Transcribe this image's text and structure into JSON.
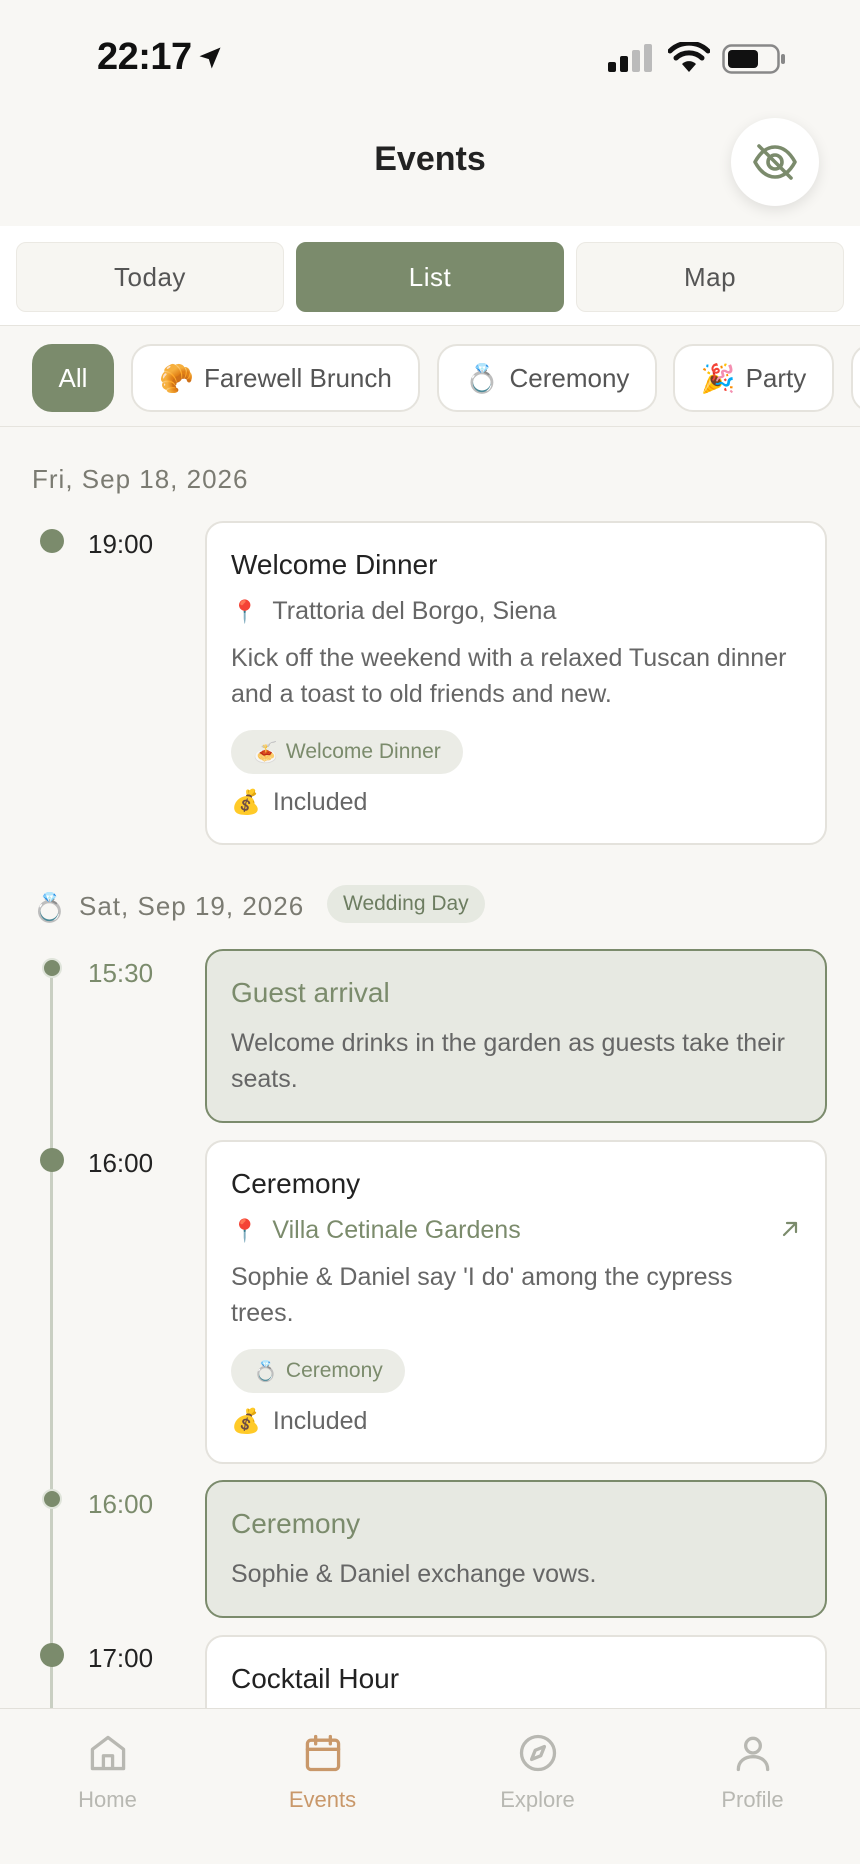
{
  "status": {
    "time": "22:17"
  },
  "header": {
    "title": "Events"
  },
  "segments": [
    {
      "label": "Today",
      "active": false
    },
    {
      "label": "List",
      "active": true
    },
    {
      "label": "Map",
      "active": false
    }
  ],
  "filters": [
    {
      "label": "All",
      "emoji": "",
      "active": true
    },
    {
      "label": "Farewell Brunch",
      "emoji": "🥐",
      "active": false
    },
    {
      "label": "Ceremony",
      "emoji": "💍",
      "active": false
    },
    {
      "label": "Party",
      "emoji": "🎉",
      "active": false
    }
  ],
  "days": [
    {
      "date": "Fri, Sep 18, 2026",
      "events": [
        {
          "time": "19:00",
          "title": "Welcome Dinner",
          "location": "Trattoria del Borgo, Siena",
          "description": "Kick off the weekend with a relaxed Tuscan dinner and a toast to old friends and new.",
          "tag": "Welcome Dinner",
          "tag_emoji": "🍝",
          "price": "Included",
          "price_emoji": "💰"
        }
      ]
    },
    {
      "date": "Sat, Sep 19, 2026",
      "date_emoji": "💍",
      "badge": "Wedding Day",
      "events": [
        {
          "time": "15:30",
          "title": "Guest arrival",
          "description": "Welcome drinks in the garden as guests take their seats."
        },
        {
          "time": "16:00",
          "title": "Ceremony",
          "location": "Villa Cetinale Gardens",
          "description": "Sophie & Daniel say 'I do' among the cypress trees.",
          "tag": "Ceremony",
          "tag_emoji": "💍",
          "price": "Included",
          "price_emoji": "💰"
        },
        {
          "time": "16:00",
          "title": "Ceremony",
          "description": "Sophie & Daniel exchange vows."
        },
        {
          "time": "17:00",
          "title": "Cocktail Hour"
        }
      ]
    }
  ],
  "pin_emoji": "📍",
  "tabs": [
    {
      "label": "Home",
      "icon": "home-icon",
      "active": false
    },
    {
      "label": "Events",
      "icon": "calendar-icon",
      "active": true
    },
    {
      "label": "Explore",
      "icon": "compass-icon",
      "active": false
    },
    {
      "label": "Profile",
      "icon": "person-icon",
      "active": false
    }
  ],
  "colors": {
    "accent": "#7b8b6c",
    "tab_active": "#c9986a",
    "background": "#f8f7f4"
  }
}
